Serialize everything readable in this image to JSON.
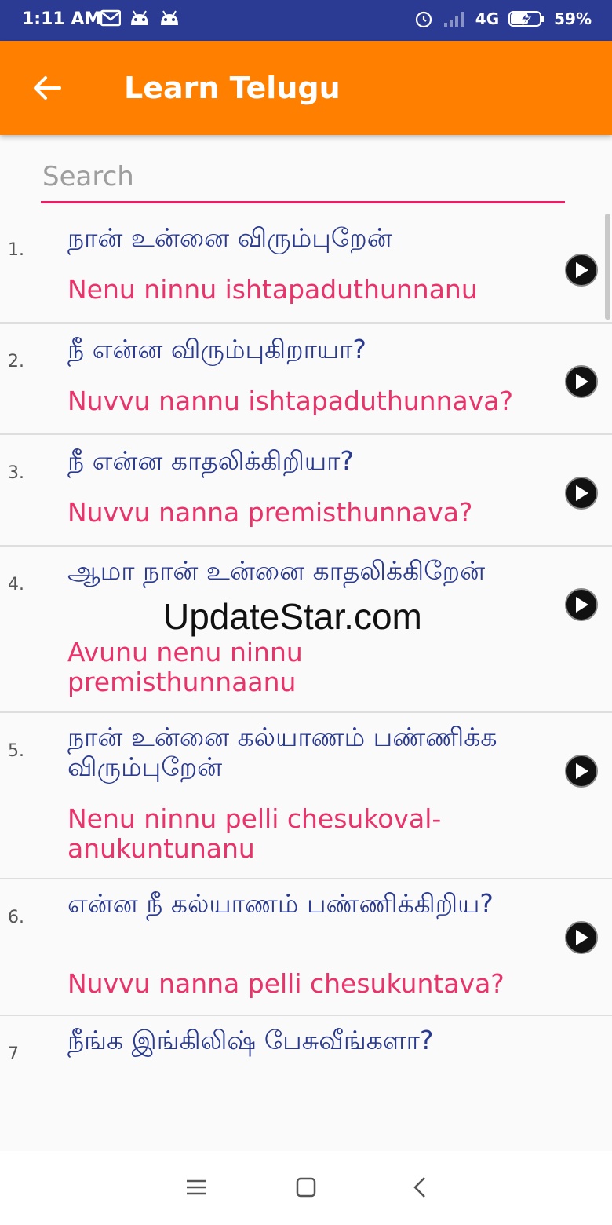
{
  "status_bar": {
    "time": "1:11 AM",
    "network": "4G",
    "battery": "59%",
    "icons": [
      "mail-icon",
      "android-icon",
      "android-icon",
      "alarm-icon",
      "signal-icon",
      "battery-charging-icon"
    ]
  },
  "app_bar": {
    "title": "Learn Telugu",
    "back_icon": "arrow-left-icon",
    "background_color": "#ff8000"
  },
  "search": {
    "placeholder": "Search",
    "value": "",
    "underline_color": "#e91e63"
  },
  "phrases": [
    {
      "number": "1.",
      "tamil": "நான் உன்னை விரும்புறேன்",
      "telugu": "Nenu ninnu ishtapaduthunnanu"
    },
    {
      "number": "2.",
      "tamil": "நீ என்ன விரும்புகிறாயா?",
      "telugu": "Nuvvu nannu ishtapaduthunnava?"
    },
    {
      "number": "3.",
      "tamil": "நீ என்ன காதலிக்கிறியா?",
      "telugu": "Nuvvu nanna premisthunnava?"
    },
    {
      "number": "4.",
      "tamil": "ஆமா நான் உன்னை காதலிக்கிறேன்",
      "telugu": "Avunu nenu ninnu premisthunnaanu"
    },
    {
      "number": "5.",
      "tamil": "நான் உன்னை கல்யாணம் பண்ணிக்க விரும்புறேன்",
      "telugu": "Nenu ninnu pelli chesukoval-anukuntunanu"
    },
    {
      "number": "6.",
      "tamil": "என்ன நீ கல்யாணம் பண்ணிக்கிறிய?",
      "telugu": "Nuvvu nanna pelli chesukuntava?"
    },
    {
      "number": "7",
      "tamil": "நீங்க இங்கிலிஷ் பேசுவீங்களா?",
      "telugu": ""
    }
  ],
  "watermark": "UpdateStar.com",
  "colors": {
    "status_bar": "#2b3b94",
    "tamil_text": "#2a3a8f",
    "telugu_text": "#e8336b"
  },
  "nav_bar": {
    "icons": [
      "menu-icon",
      "home-square-icon",
      "back-chevron-icon"
    ]
  }
}
